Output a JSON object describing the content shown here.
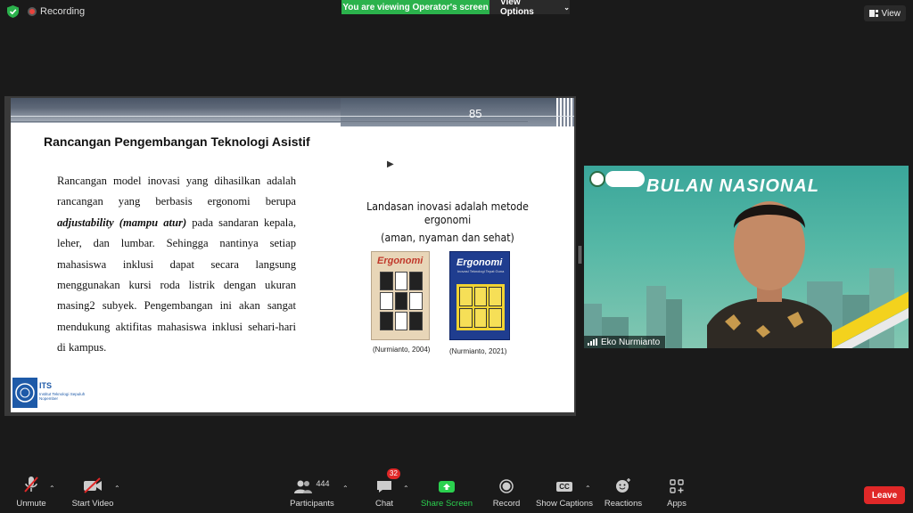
{
  "topbar": {
    "recording_label": "Recording",
    "viewing_banner": "You are viewing Operator's screen",
    "view_options_label": "View Options",
    "view_button_label": "View"
  },
  "slide": {
    "page_number": "85",
    "title": "Rancangan Pengembangan Teknologi Asistif",
    "para_part1": "Rancangan model inovasi yang dihasilkan adalah rancangan yang berbasis ergonomi berupa ",
    "para_emph": "adjustability (mampu atur)",
    "para_part2": " pada sandaran kepala, leher, dan lumbar. Sehingga nantinya setiap mahasiswa inklusi dapat secara langsung menggunakan kursi roda listrik dengan ukuran masing2 subyek. Pengembangan ini akan sangat mendukung aktifitas mahasiswa inklusi sehari-hari di kampus.",
    "landasan_line1": "Landasan inovasi adalah metode ergonomi",
    "landasan_line2": "(aman, nyaman dan sehat)",
    "book1_title": "Ergonomi",
    "book2_title": "Ergonomi",
    "book2_subtitle": "Inovasi Teknologi Tepat Guna",
    "caption1": "(Nurmianto, 2004)",
    "caption2": "(Nurmianto, 2021)",
    "logo_text": "ITS",
    "logo_sub": "Institut Teknologi Sepuluh Nopember"
  },
  "video": {
    "banner_text": "BULAN NASIONAL",
    "participant_name": "Eko Nurmianto"
  },
  "toolbar": {
    "unmute": "Unmute",
    "start_video": "Start Video",
    "participants_count": "444",
    "participants": "Participants",
    "chat_badge": "32",
    "chat": "Chat",
    "share_screen": "Share Screen",
    "record": "Record",
    "captions_icon": "CC",
    "show_captions": "Show Captions",
    "reactions": "Reactions",
    "apps": "Apps",
    "leave": "Leave"
  },
  "colors": {
    "share_green": "#2bb24c",
    "leave_red": "#e02828",
    "background": "#1a1a1a"
  }
}
